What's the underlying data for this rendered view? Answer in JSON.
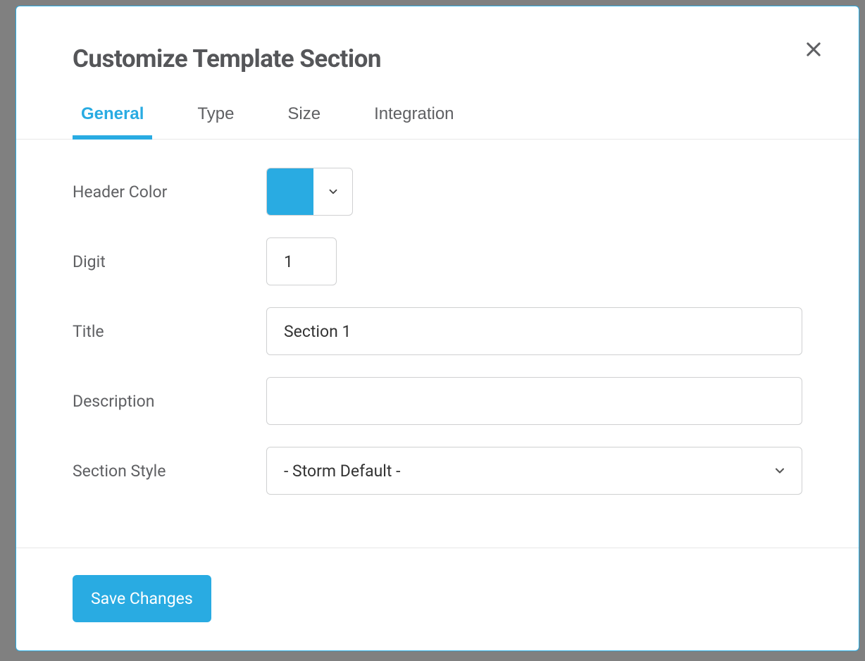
{
  "modal": {
    "title": "Customize Template Section"
  },
  "tabs": {
    "general": "General",
    "type": "Type",
    "size": "Size",
    "integration": "Integration"
  },
  "form": {
    "header_color_label": "Header Color",
    "header_color_value": "#29abe2",
    "digit_label": "Digit",
    "digit_value": "1",
    "title_label": "Title",
    "title_value": "Section 1",
    "description_label": "Description",
    "description_value": "",
    "section_style_label": "Section Style",
    "section_style_value": "- Storm Default -"
  },
  "buttons": {
    "save": "Save Changes"
  }
}
